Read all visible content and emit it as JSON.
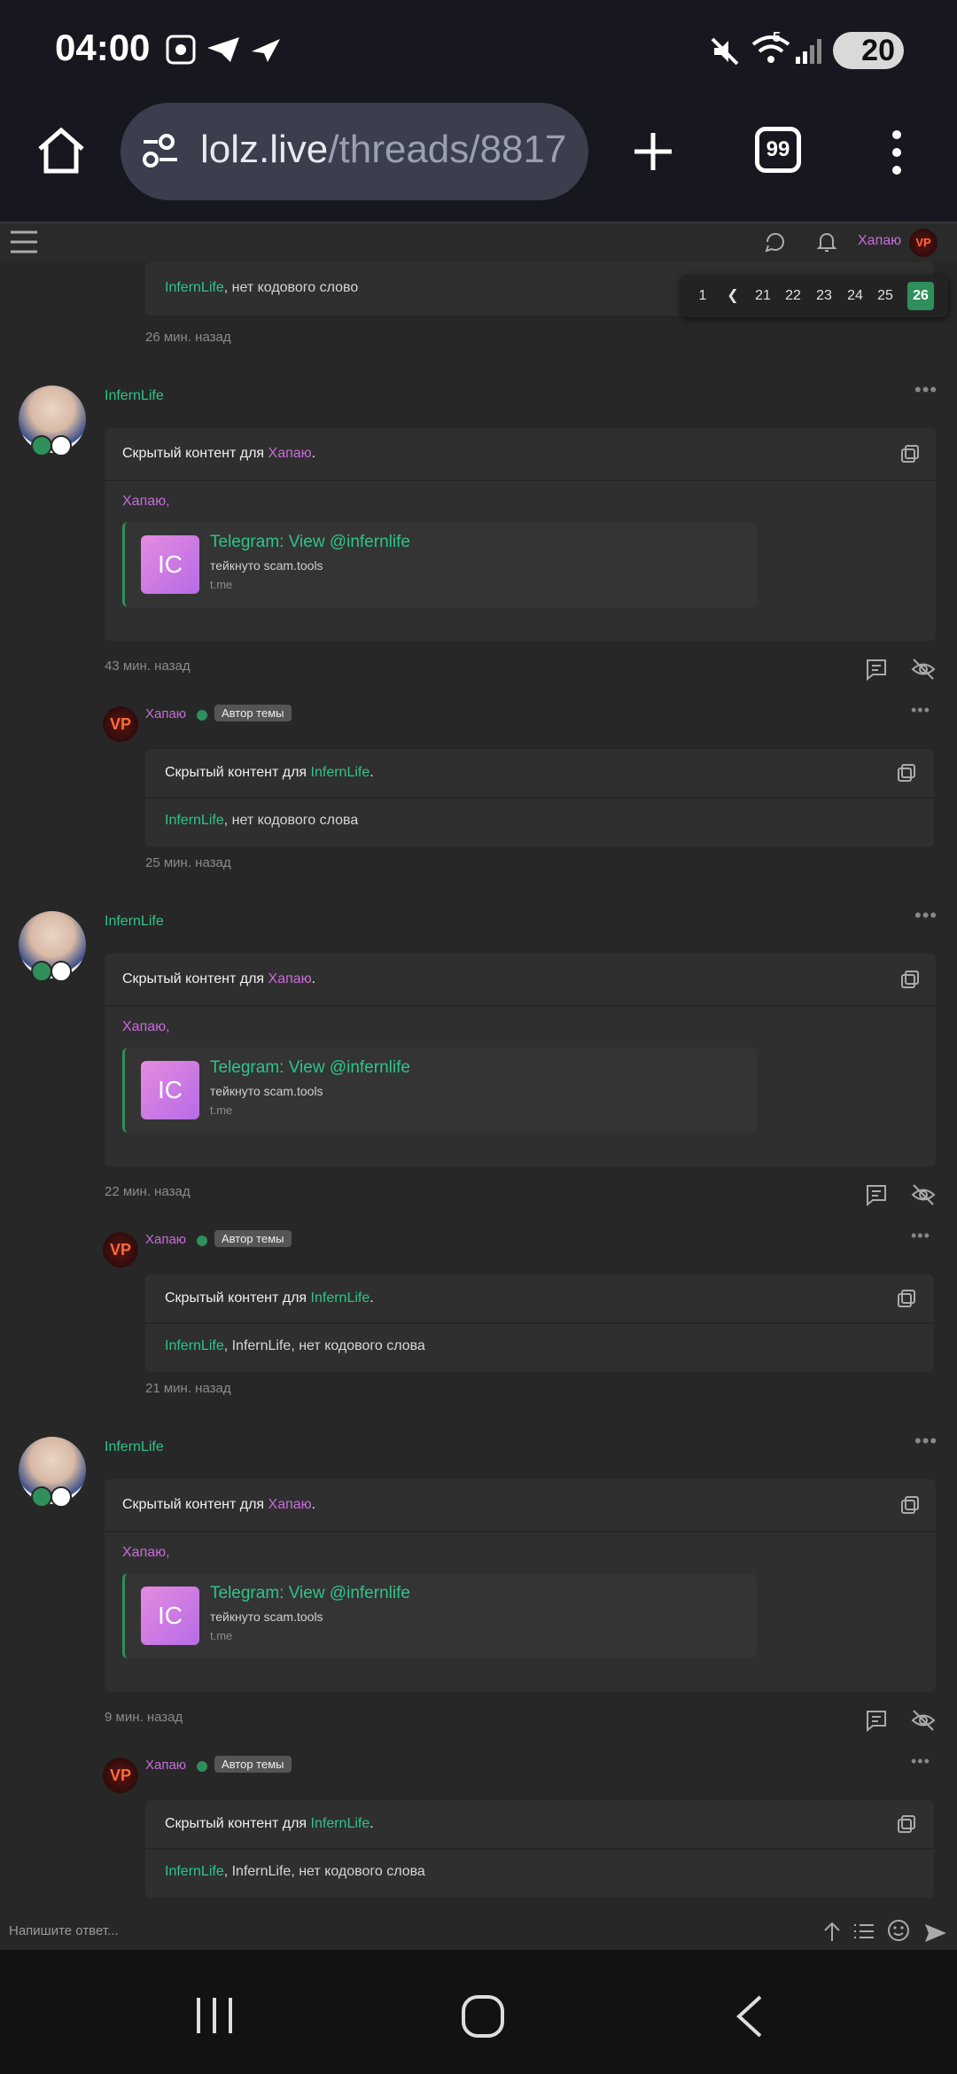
{
  "status_bar": {
    "time": "04:00",
    "battery": "20",
    "wifi_badge": "5"
  },
  "browser": {
    "url_host": "lolz.live",
    "url_path": "/threads/8817",
    "tab_count": "99"
  },
  "forum_header": {
    "username": "Хапаю"
  },
  "pagination": {
    "pages": [
      "1",
      "21",
      "22",
      "23",
      "24",
      "25",
      "26"
    ],
    "prev": "❮",
    "active": "26"
  },
  "posts": [
    {
      "top_reply_text_user": "InfernLife",
      "top_reply_text_rest": ", нет кодового слово",
      "top_reply_time": "26 мин. назад"
    },
    {
      "author": "InfernLife",
      "hidden_label": "Скрытый контент для",
      "hidden_for": "Хапаю",
      "mention": "Хапаю,",
      "card_title": "Telegram: View @infernlife",
      "card_desc": "тейкнуто scam.tools",
      "card_domain": "t.me",
      "card_icon": "IC",
      "time": "43 мин. назад",
      "reply": {
        "author": "Хапаю",
        "tag": "Автор темы",
        "hidden_label": "Скрытый контент для",
        "hidden_for": "InfernLife",
        "text_user": "InfernLife",
        "text_rest": ", нет кодового слова",
        "time": "25 мин. назад"
      }
    },
    {
      "author": "InfernLife",
      "hidden_label": "Скрытый контент для",
      "hidden_for": "Хапаю",
      "mention": "Хапаю,",
      "card_title": "Telegram: View @infernlife",
      "card_desc": "тейкнуто scam.tools",
      "card_domain": "t.me",
      "card_icon": "IC",
      "time": "22 мин. назад",
      "reply": {
        "author": "Хапаю",
        "tag": "Автор темы",
        "hidden_label": "Скрытый контент для",
        "hidden_for": "InfernLife",
        "text_user": "InfernLife",
        "text_rest": ", InfernLife, нет кодового слова",
        "time": "21 мин. назад"
      }
    },
    {
      "author": "InfernLife",
      "hidden_label": "Скрытый контент для",
      "hidden_for": "Хапаю",
      "mention": "Хапаю,",
      "card_title": "Telegram: View @infernlife",
      "card_desc": "тейкнуто scam.tools",
      "card_domain": "t.me",
      "card_icon": "IC",
      "time": "9 мин. назад",
      "reply": {
        "author": "Хапаю",
        "tag": "Автор темы",
        "hidden_label": "Скрытый контент для",
        "hidden_for": "InfernLife",
        "text_user": "InfernLife",
        "text_rest": ", InfernLife, нет кодового слова"
      }
    }
  ],
  "composer": {
    "placeholder": "Напишите ответ..."
  },
  "avatar_text": "VP",
  "colors": {
    "accent_green": "#2e8f5a",
    "name_green": "#2ec48a",
    "name_purple": "#c76cdb",
    "background": "#272727"
  }
}
